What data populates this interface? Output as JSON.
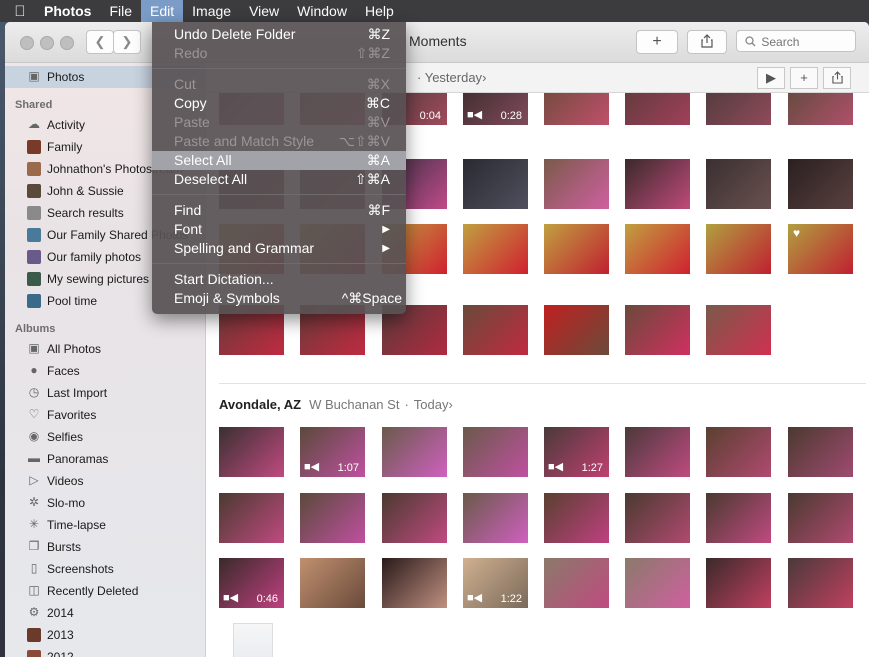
{
  "menubar": {
    "app": "Photos",
    "items": [
      "File",
      "Edit",
      "Image",
      "View",
      "Window",
      "Help"
    ]
  },
  "window": {
    "title": "Moments",
    "add": "+",
    "search_placeholder": "Search"
  },
  "subbar": {
    "crumb": "Yesterday"
  },
  "sidebar": {
    "photos": "Photos",
    "shared_header": "Shared",
    "shared": [
      "Activity",
      "Family",
      "Johnathon's Photostream",
      "John & Sussie",
      "Search results",
      "Our Family Shared Photos",
      "Our family photos",
      "My sewing pictures",
      "Pool time"
    ],
    "albums_header": "Albums",
    "albums": [
      "All Photos",
      "Faces",
      "Last Import",
      "Favorites",
      "Selfies",
      "Panoramas",
      "Videos",
      "Slo-mo",
      "Time-lapse",
      "Bursts",
      "Screenshots",
      "Recently Deleted",
      "2014",
      "2013",
      "2012"
    ]
  },
  "edit_menu": {
    "undo": "Undo Delete Folder",
    "undo_key": "⌘Z",
    "redo": "Redo",
    "redo_key": "⇧⌘Z",
    "cut": "Cut",
    "cut_key": "⌘X",
    "copy": "Copy",
    "copy_key": "⌘C",
    "paste": "Paste",
    "paste_key": "⌘V",
    "paste_match": "Paste and Match Style",
    "paste_match_key": "⌥⇧⌘V",
    "select_all": "Select All",
    "select_all_key": "⌘A",
    "deselect_all": "Deselect All",
    "deselect_all_key": "⇧⌘A",
    "find": "Find",
    "find_key": "⌘F",
    "font": "Font",
    "font_key": "▶",
    "spelling": "Spelling and Grammar",
    "spelling_key": "▶",
    "dictation": "Start Dictation...",
    "emoji": "Emoji & Symbols",
    "emoji_key": "^⌘Space"
  },
  "moment1": {
    "durations": [
      "0:04",
      "0:28"
    ]
  },
  "moment2": {
    "place": "Avondale, AZ",
    "street": "W Buchanan St",
    "day": "Today",
    "durations": [
      "1:07",
      "1:27",
      "0:46",
      "1:22"
    ]
  }
}
